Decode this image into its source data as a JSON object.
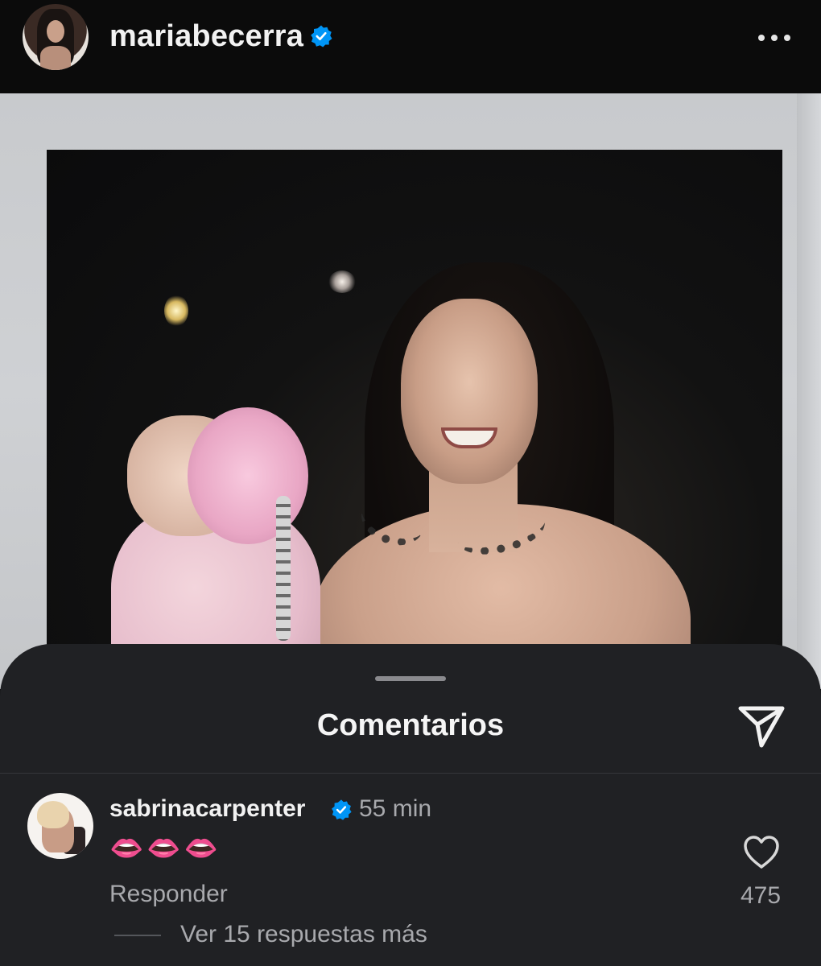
{
  "post": {
    "username": "mariabecerra",
    "verified": true
  },
  "comments_sheet": {
    "title": "Comentarios",
    "comment": {
      "username": "sabrinacarpenter",
      "verified": true,
      "time": "55 min",
      "text": "👄👄👄",
      "likes": "475",
      "reply_label": "Responder",
      "view_replies_label": "Ver 15 respuestas más"
    }
  },
  "icons": {
    "verified": "verified-badge-icon",
    "more": "more-options-icon",
    "share": "send-icon",
    "like": "heart-icon"
  },
  "colors": {
    "verified_blue": "#0095f6",
    "sheet_bg": "#202124",
    "muted_text": "#a8a9ad"
  }
}
